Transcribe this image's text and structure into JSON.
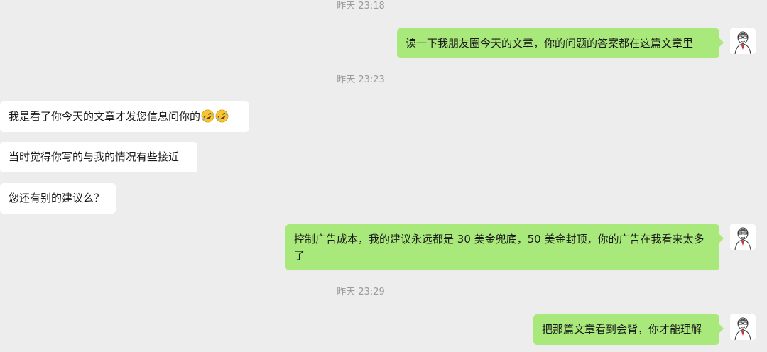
{
  "chat": {
    "timestamps": [
      "昨天 23:18",
      "昨天 23:23",
      "昨天 23:29"
    ],
    "messages": [
      {
        "side": "out",
        "text": "读一下我朋友圈今天的文章，你的问题的答案都在这篇文章里"
      },
      {
        "side": "in",
        "text": "我是看了你今天的文章才发您信息问你的",
        "emojis": [
          "rolling-laughing-emoji",
          "rolling-laughing-emoji"
        ]
      },
      {
        "side": "in",
        "text": "当时觉得你写的与我的情况有些接近"
      },
      {
        "side": "in",
        "text": "您还有别的建议么？"
      },
      {
        "side": "out",
        "text": "控制广告成本，我的建议永远都是 30 美金兜底，50 美金封顶，你的广告在我看来太多了"
      },
      {
        "side": "out",
        "text": "把那篇文章看到会背，你才能理解"
      }
    ]
  },
  "colors": {
    "background": "#ededed",
    "outgoing_bubble": "#a9e87a",
    "incoming_bubble": "#ffffff",
    "timestamp_text": "#9b9b9b"
  }
}
